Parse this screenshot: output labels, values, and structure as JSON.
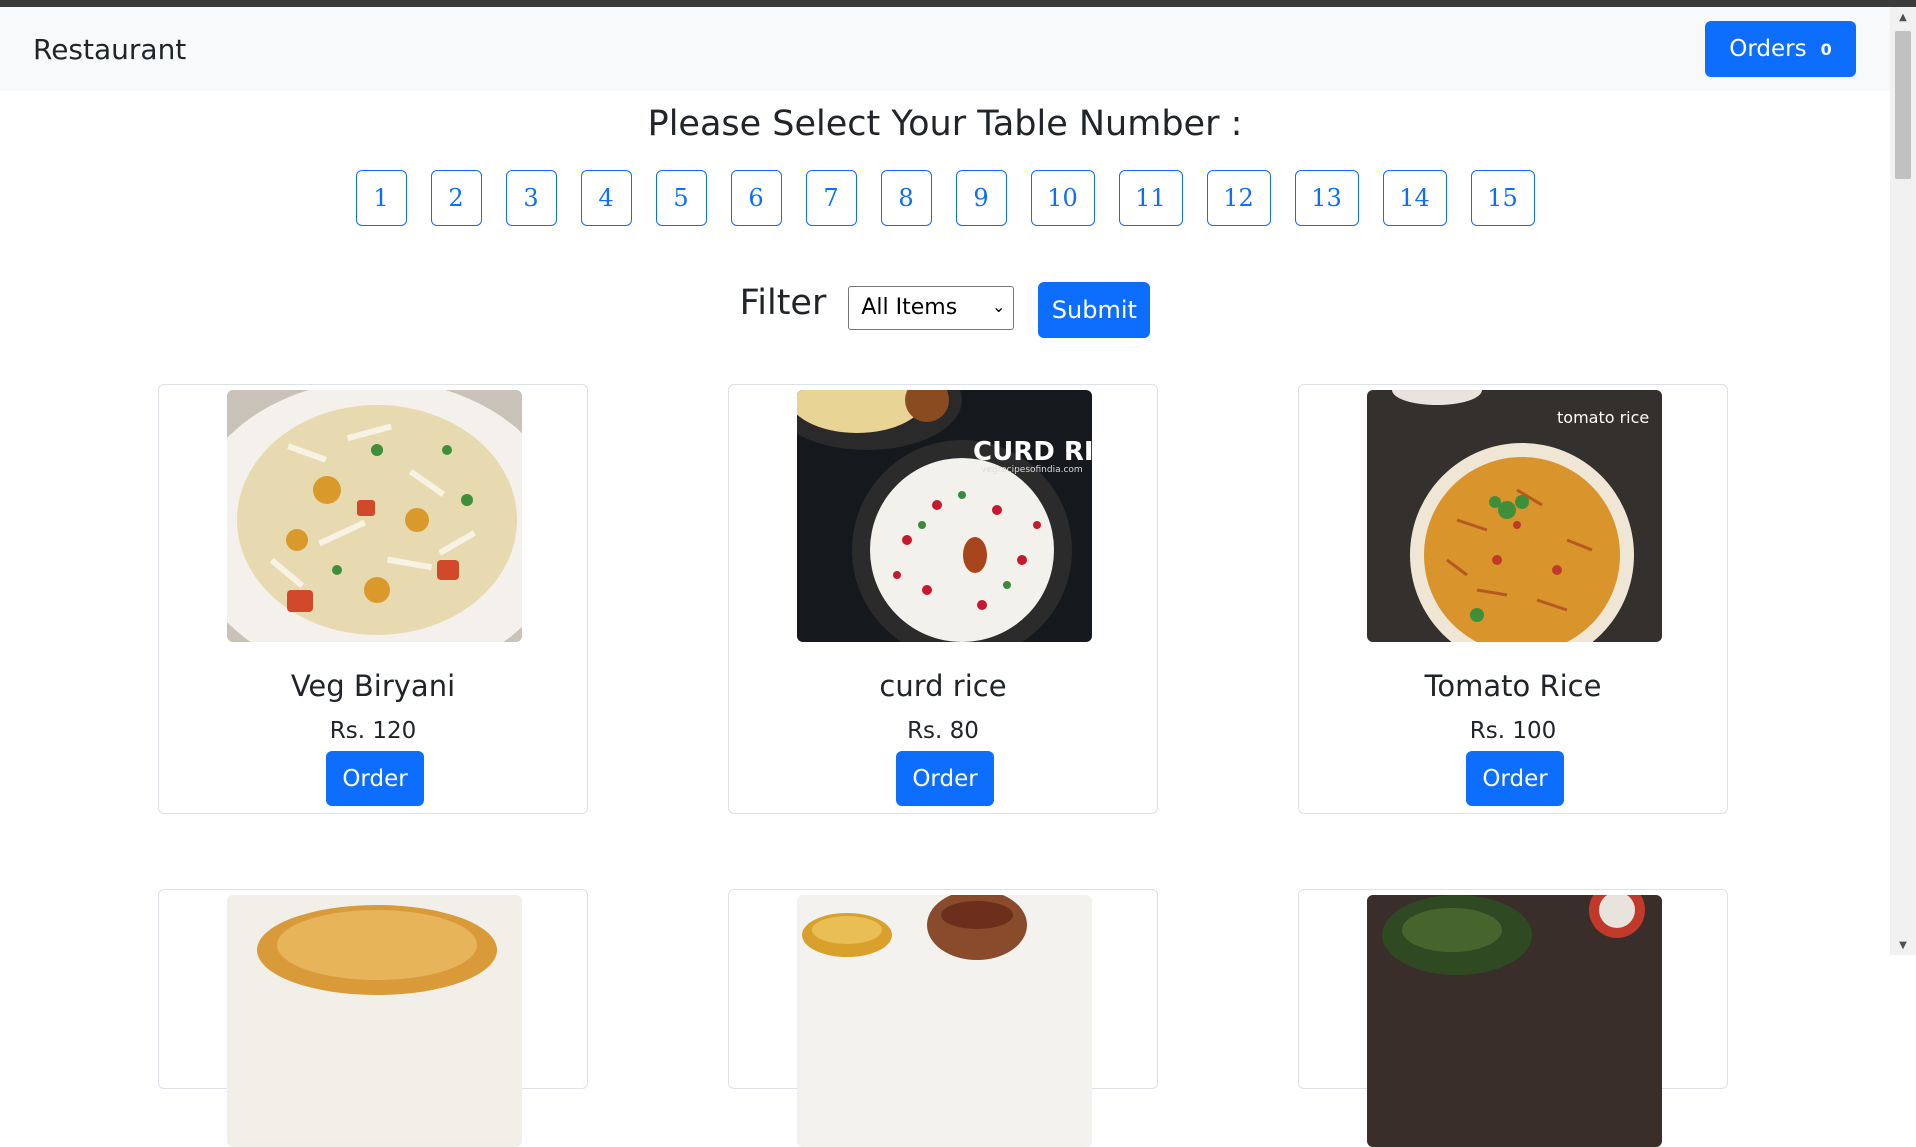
{
  "navbar": {
    "brand": "Restaurant",
    "orders_label": "Orders",
    "orders_count": "0"
  },
  "table_select": {
    "title": "Please Select Your Table Number :",
    "tables": [
      "1",
      "2",
      "3",
      "4",
      "5",
      "6",
      "7",
      "8",
      "9",
      "10",
      "11",
      "12",
      "13",
      "14",
      "15"
    ]
  },
  "filter": {
    "label": "Filter",
    "selected": "All Items",
    "submit_label": "Submit"
  },
  "menu": {
    "items": [
      {
        "name": "Veg Biryani",
        "price": "Rs. 120",
        "order_label": "Order",
        "image": "veg-biryani-photo"
      },
      {
        "name": "curd rice",
        "price": "Rs. 80",
        "order_label": "Order",
        "image": "curd-rice-photo",
        "image_text": "CURD RICE",
        "image_subtext": "vegrecipesofindia.com"
      },
      {
        "name": "Tomato Rice",
        "price": "Rs. 100",
        "order_label": "Order",
        "image": "tomato-rice-photo",
        "image_text": "tomato rice"
      },
      {
        "image": "poori-photo"
      },
      {
        "image": "curry-tea-photo"
      },
      {
        "image": "palak-dish-photo"
      }
    ]
  },
  "colors": {
    "primary": "#0d6efd",
    "navbar_bg": "#f8f9fa",
    "card_border": "#dee2e6"
  }
}
